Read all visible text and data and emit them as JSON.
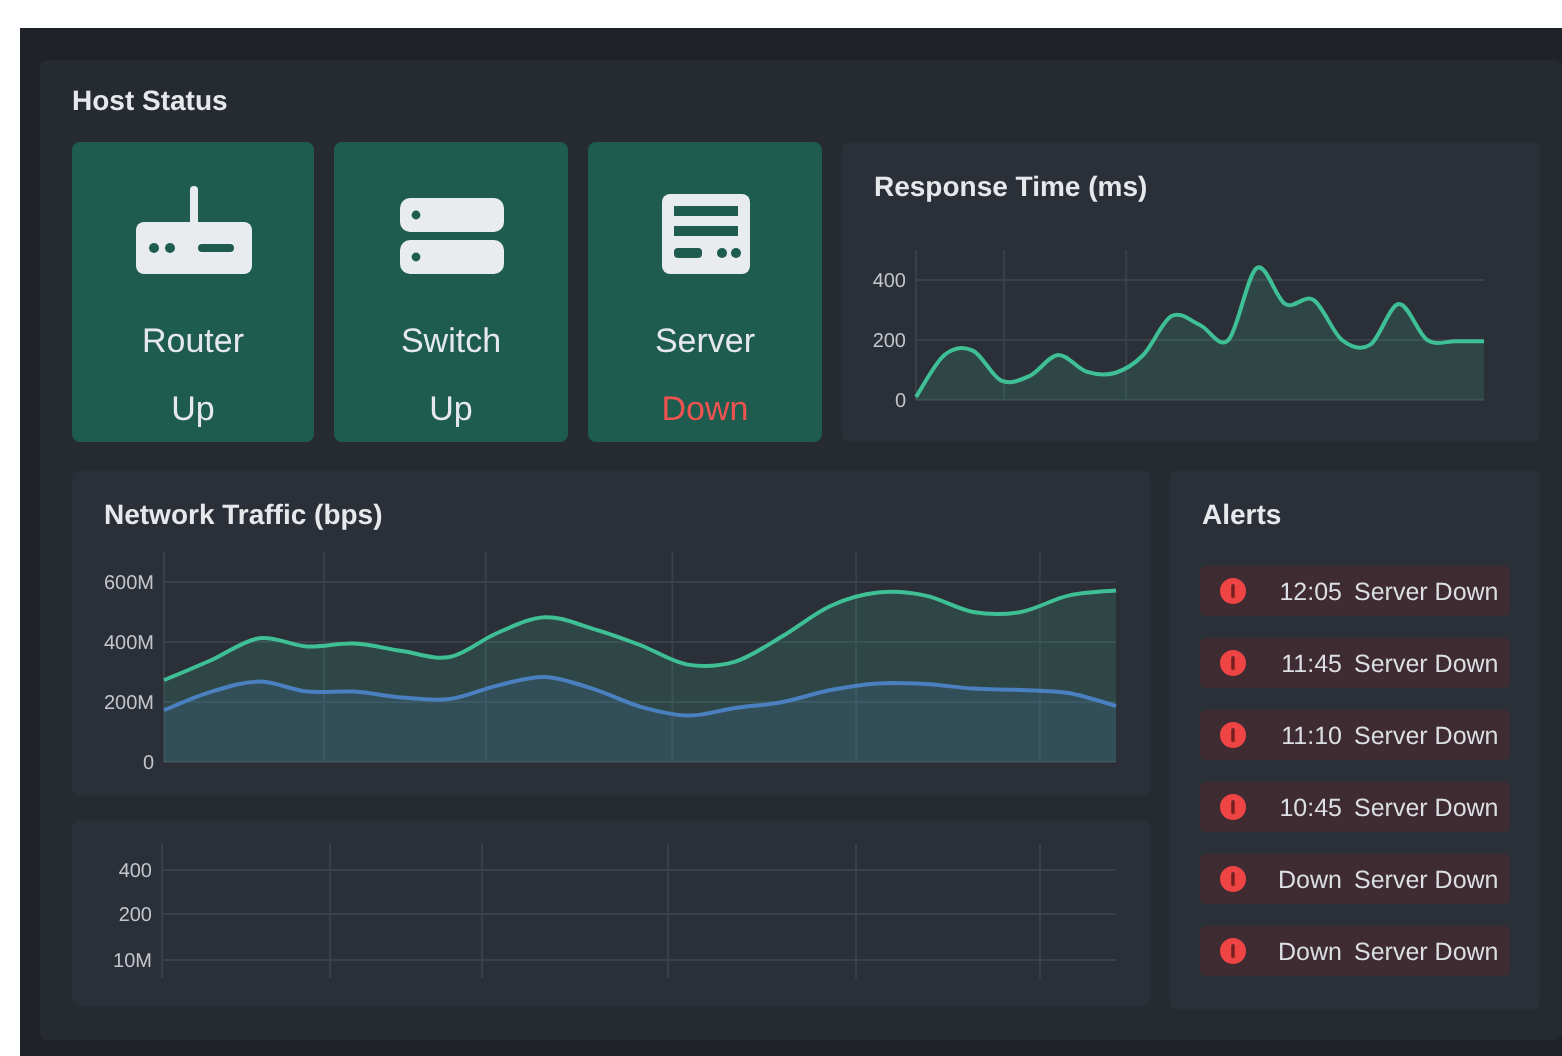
{
  "host_status": {
    "title": "Host Status",
    "hosts": [
      {
        "kind": "router",
        "name": "Router",
        "status": "Up",
        "down": false
      },
      {
        "kind": "switch",
        "name": "Switch",
        "status": "Up",
        "down": false
      },
      {
        "kind": "server",
        "name": "Server",
        "status": "Down",
        "down": true
      }
    ]
  },
  "response_time": {
    "title": "Response Time (ms)",
    "chart_data": {
      "type": "area",
      "ylim": [
        0,
        500
      ],
      "yticks": [
        0,
        200,
        400
      ],
      "grid": true,
      "series": [
        {
          "color": "#3fbf95",
          "values": [
            10,
            150,
            165,
            65,
            80,
            150,
            95,
            90,
            150,
            280,
            250,
            200,
            440,
            320,
            333,
            200,
            185,
            320,
            200,
            196,
            196
          ]
        }
      ]
    }
  },
  "network_traffic": {
    "title": "Network Traffic (bps)",
    "chart_data": {
      "type": "area",
      "ylim": [
        0,
        700
      ],
      "yticks": [
        {
          "value": 0,
          "label": "0"
        },
        {
          "value": 200,
          "label": "200M"
        },
        {
          "value": 400,
          "label": "400M"
        },
        {
          "value": 600,
          "label": "600M"
        }
      ],
      "grid": true,
      "series": [
        {
          "color": "#3fbf95",
          "values": [
            273,
            340,
            413,
            385,
            395,
            370,
            350,
            430,
            483,
            445,
            390,
            325,
            335,
            420,
            520,
            565,
            555,
            500,
            500,
            555,
            572
          ]
        },
        {
          "color": "#4a80c0",
          "values": [
            173,
            235,
            268,
            235,
            235,
            215,
            210,
            255,
            283,
            245,
            185,
            155,
            180,
            200,
            240,
            262,
            260,
            245,
            240,
            230,
            187
          ]
        }
      ]
    }
  },
  "empty_chart": {
    "y_labels": [
      "400",
      "200",
      "10M"
    ]
  },
  "alerts": {
    "title": "Alerts",
    "items": [
      {
        "time": "12:05",
        "message": "Server Down"
      },
      {
        "time": "11:45",
        "message": "Server Down"
      },
      {
        "time": "11:10",
        "message": "Server Down"
      },
      {
        "time": "10:45",
        "message": "Server Down"
      },
      {
        "time": "Down",
        "message": "Server Down"
      },
      {
        "time": "Down",
        "message": "Server Down"
      }
    ]
  }
}
